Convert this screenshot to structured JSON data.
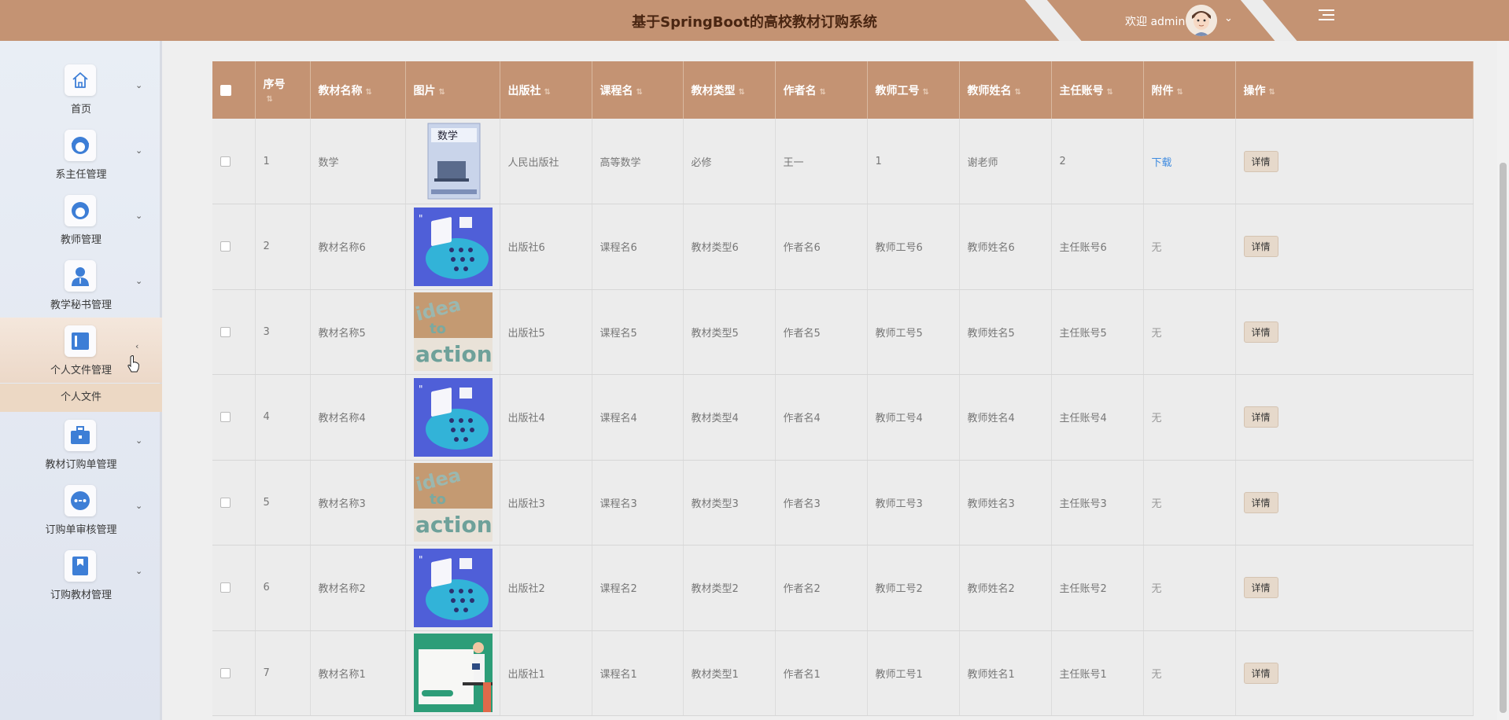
{
  "header": {
    "title": "基于SpringBoot的高校教材订购系统",
    "welcome": "欢迎 admin",
    "dropdown_icon": "chevron-down-icon",
    "menu_icon": "menu-collapse-icon"
  },
  "sidebar": {
    "items": [
      {
        "label": "首页",
        "icon": "home-icon",
        "arrow": "⌄"
      },
      {
        "label": "系主任管理",
        "icon": "user-face-icon",
        "arrow": "⌄"
      },
      {
        "label": "教师管理",
        "icon": "user-face-icon",
        "arrow": "⌄"
      },
      {
        "label": "教学秘书管理",
        "icon": "person-icon",
        "arrow": "⌄"
      },
      {
        "label": "个人文件管理",
        "icon": "file-icon",
        "arrow": "‹"
      },
      {
        "label": "教材订购单管理",
        "icon": "briefcase-icon",
        "arrow": "⌄"
      },
      {
        "label": "订购单审核管理",
        "icon": "review-icon",
        "arrow": "⌄"
      },
      {
        "label": "订购教材管理",
        "icon": "bookmark-icon",
        "arrow": "⌄"
      }
    ],
    "submenu_label": "个人文件"
  },
  "table": {
    "columns": [
      "序号",
      "教材名称",
      "图片",
      "出版社",
      "课程名",
      "教材类型",
      "作者名",
      "教师工号",
      "教师姓名",
      "主任账号",
      "附件",
      "操作"
    ],
    "detail_label": "详情",
    "rows": [
      {
        "no": "1",
        "name": "数学",
        "image": "math-book",
        "publisher": "人民出版社",
        "course": "高等数学",
        "type": "必修",
        "author": "王一",
        "teacher_id": "1",
        "teacher_name": "谢老师",
        "director": "2",
        "attachment": "下载"
      },
      {
        "no": "2",
        "name": "教材名称6",
        "image": "classroom",
        "publisher": "出版社6",
        "course": "课程名6",
        "type": "教材类型6",
        "author": "作者名6",
        "teacher_id": "教师工号6",
        "teacher_name": "教师姓名6",
        "director": "主任账号6",
        "attachment": "无"
      },
      {
        "no": "3",
        "name": "教材名称5",
        "image": "idea-action",
        "publisher": "出版社5",
        "course": "课程名5",
        "type": "教材类型5",
        "author": "作者名5",
        "teacher_id": "教师工号5",
        "teacher_name": "教师姓名5",
        "director": "主任账号5",
        "attachment": "无"
      },
      {
        "no": "4",
        "name": "教材名称4",
        "image": "classroom",
        "publisher": "出版社4",
        "course": "课程名4",
        "type": "教材类型4",
        "author": "作者名4",
        "teacher_id": "教师工号4",
        "teacher_name": "教师姓名4",
        "director": "主任账号4",
        "attachment": "无"
      },
      {
        "no": "5",
        "name": "教材名称3",
        "image": "idea-action",
        "publisher": "出版社3",
        "course": "课程名3",
        "type": "教材类型3",
        "author": "作者名3",
        "teacher_id": "教师工号3",
        "teacher_name": "教师姓名3",
        "director": "主任账号3",
        "attachment": "无"
      },
      {
        "no": "6",
        "name": "教材名称2",
        "image": "classroom",
        "publisher": "出版社2",
        "course": "课程名2",
        "type": "教材类型2",
        "author": "作者名2",
        "teacher_id": "教师工号2",
        "teacher_name": "教师姓名2",
        "director": "主任账号2",
        "attachment": "无"
      },
      {
        "no": "7",
        "name": "教材名称1",
        "image": "teacher-board",
        "publisher": "出版社1",
        "course": "课程名1",
        "type": "教材类型1",
        "author": "作者名1",
        "teacher_id": "教师工号1",
        "teacher_name": "教师姓名1",
        "director": "主任账号1",
        "attachment": "无"
      }
    ]
  },
  "colors": {
    "accent": "#c49373",
    "header_text": "#4a2612",
    "link": "#3f8be0",
    "icon_blue": "#3d7ed6"
  }
}
